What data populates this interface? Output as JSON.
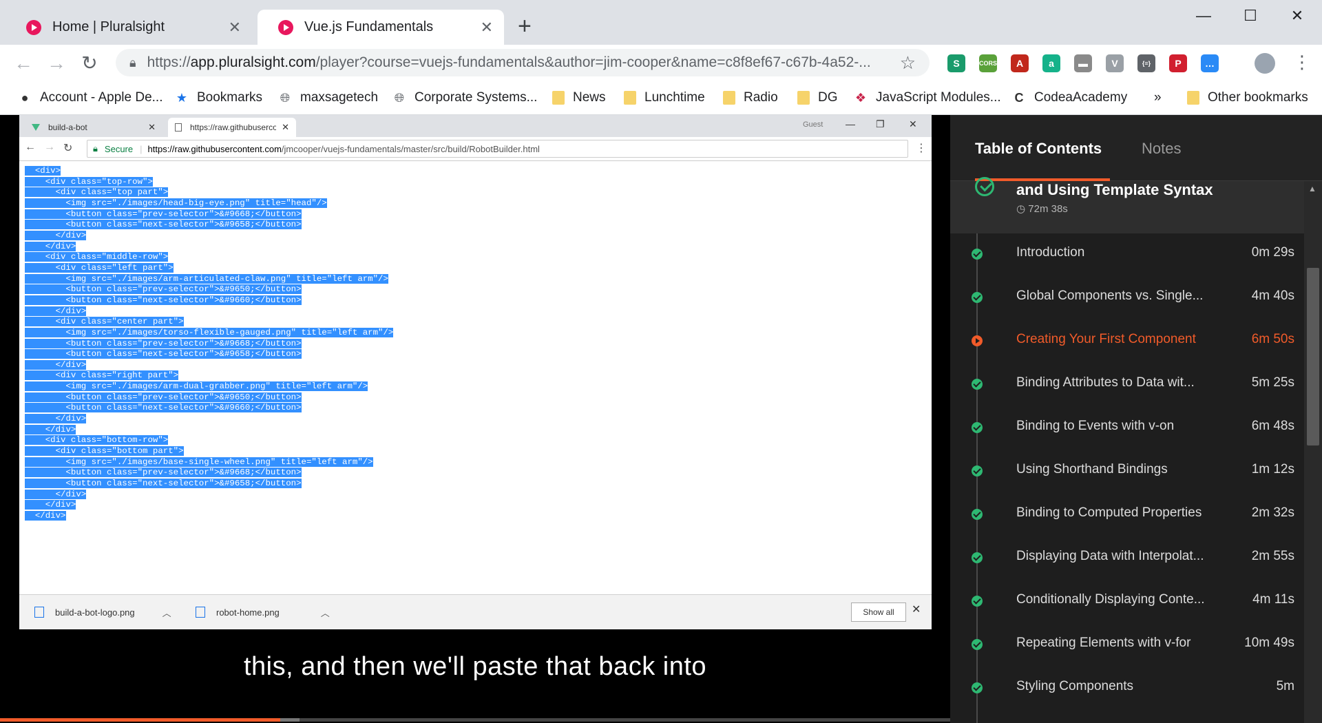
{
  "browser": {
    "tabs": [
      {
        "title": "Home | Pluralsight",
        "active": false
      },
      {
        "title": "Vue.js Fundamentals",
        "active": true
      }
    ],
    "url": {
      "prefix": "https://",
      "domain": "app.pluralsight.com",
      "path": "/player?course=vuejs-fundamentals&author=jim-cooper&name=c8f8ef67-c67b-4a52-..."
    },
    "extensions": [
      {
        "icon": "stylish-icon",
        "color": "#1a9b6b",
        "glyph": "S"
      },
      {
        "icon": "cors-icon",
        "color": "#5aa13a",
        "glyph": "CORS"
      },
      {
        "icon": "pdf-icon",
        "color": "#c1281c",
        "glyph": "A"
      },
      {
        "icon": "amazon-icon",
        "color": "#15b28a",
        "glyph": "a"
      },
      {
        "icon": "comment-icon",
        "color": "#8a8a8a",
        "glyph": "▬"
      },
      {
        "icon": "vuejs-devtools-icon",
        "color": "#9aa0a6",
        "glyph": "V"
      },
      {
        "icon": "json-icon",
        "color": "#5f6368",
        "glyph": "{≡}"
      },
      {
        "icon": "pinterest-icon",
        "color": "#d11f2f",
        "glyph": "P"
      },
      {
        "icon": "messenger-icon",
        "color": "#2a8af6",
        "glyph": "…"
      }
    ],
    "bookmarks": [
      {
        "label": "Account - Apple De...",
        "icon": "apple-icon"
      },
      {
        "label": "Bookmarks",
        "icon": "star-icon"
      },
      {
        "label": "maxsagetech",
        "icon": "globe-icon"
      },
      {
        "label": "Corporate Systems...",
        "icon": "globe-icon"
      },
      {
        "label": "News",
        "icon": "folder-icon"
      },
      {
        "label": "Lunchtime",
        "icon": "folder-icon"
      },
      {
        "label": "Radio",
        "icon": "folder-icon"
      },
      {
        "label": "DG",
        "icon": "folder-icon"
      },
      {
        "label": "JavaScript Modules...",
        "icon": "codecademy-red-icon"
      },
      {
        "label": "CodeaAcademy",
        "icon": "codeacademy-icon"
      }
    ],
    "more_bookmarks": "»",
    "other_bookmarks": "Other bookmarks"
  },
  "video": {
    "inner_browser": {
      "tabs": [
        {
          "title": "build-a-bot",
          "active": false
        },
        {
          "title": "https://raw.githubuserco",
          "active": true
        }
      ],
      "guest_label": "Guest",
      "secure_label": "Secure",
      "url_domain": "https://raw.githubusercontent.com",
      "url_path": "/jmcooper/vuejs-fundamentals/master/src/build/RobotBuilder.html",
      "code_lines": [
        "  <div>",
        "    <div class=\"top-row\">",
        "      <div class=\"top part\">",
        "        <img src=\"./images/head-big-eye.png\" title=\"head\"/>",
        "        <button class=\"prev-selector\">&#9668;</button>",
        "        <button class=\"next-selector\">&#9658;</button>",
        "      </div>",
        "    </div>",
        "    <div class=\"middle-row\">",
        "      <div class=\"left part\">",
        "        <img src=\"./images/arm-articulated-claw.png\" title=\"left arm\"/>",
        "        <button class=\"prev-selector\">&#9650;</button>",
        "        <button class=\"next-selector\">&#9660;</button>",
        "      </div>",
        "      <div class=\"center part\">",
        "        <img src=\"./images/torso-flexible-gauged.png\" title=\"left arm\"/>",
        "        <button class=\"prev-selector\">&#9668;</button>",
        "        <button class=\"next-selector\">&#9658;</button>",
        "      </div>",
        "      <div class=\"right part\">",
        "        <img src=\"./images/arm-dual-grabber.png\" title=\"left arm\"/>",
        "        <button class=\"prev-selector\">&#9650;</button>",
        "        <button class=\"next-selector\">&#9660;</button>",
        "      </div>",
        "    </div>",
        "    <div class=\"bottom-row\">",
        "      <div class=\"bottom part\">",
        "        <img src=\"./images/base-single-wheel.png\" title=\"left arm\"/>",
        "        <button class=\"prev-selector\">&#9668;</button>",
        "        <button class=\"next-selector\">&#9658;</button>",
        "      </div>",
        "    </div>",
        "  </div>"
      ],
      "downloads": [
        {
          "file": "build-a-bot-logo.png"
        },
        {
          "file": "robot-home.png"
        }
      ],
      "show_all": "Show all"
    },
    "caption": "this, and then we'll paste that back into",
    "progress": 0.295,
    "buffered": 0.315,
    "accent_color": "#f15b2a"
  },
  "sidebar": {
    "tab_toc": "Table of Contents",
    "tab_notes": "Notes",
    "module": {
      "title": "and Using Template Syntax",
      "duration": "72m 38s"
    },
    "clips": [
      {
        "title": "Introduction",
        "duration": "0m 29s",
        "status": "done"
      },
      {
        "title": "Global Components vs. Single...",
        "duration": "4m 40s",
        "status": "done"
      },
      {
        "title": "Creating Your First Component",
        "duration": "6m 50s",
        "status": "current"
      },
      {
        "title": "Binding Attributes to Data wit...",
        "duration": "5m 25s",
        "status": "done"
      },
      {
        "title": "Binding to Events with v-on",
        "duration": "6m 48s",
        "status": "done"
      },
      {
        "title": "Using Shorthand Bindings",
        "duration": "1m 12s",
        "status": "done"
      },
      {
        "title": "Binding to Computed Properties",
        "duration": "2m 32s",
        "status": "done"
      },
      {
        "title": "Displaying Data with Interpolat...",
        "duration": "2m 55s",
        "status": "done"
      },
      {
        "title": "Conditionally Displaying Conte...",
        "duration": "4m 11s",
        "status": "done"
      },
      {
        "title": "Repeating Elements with v-for",
        "duration": "10m 49s",
        "status": "done"
      },
      {
        "title": "Styling Components",
        "duration": "5m",
        "status": "done"
      }
    ]
  }
}
